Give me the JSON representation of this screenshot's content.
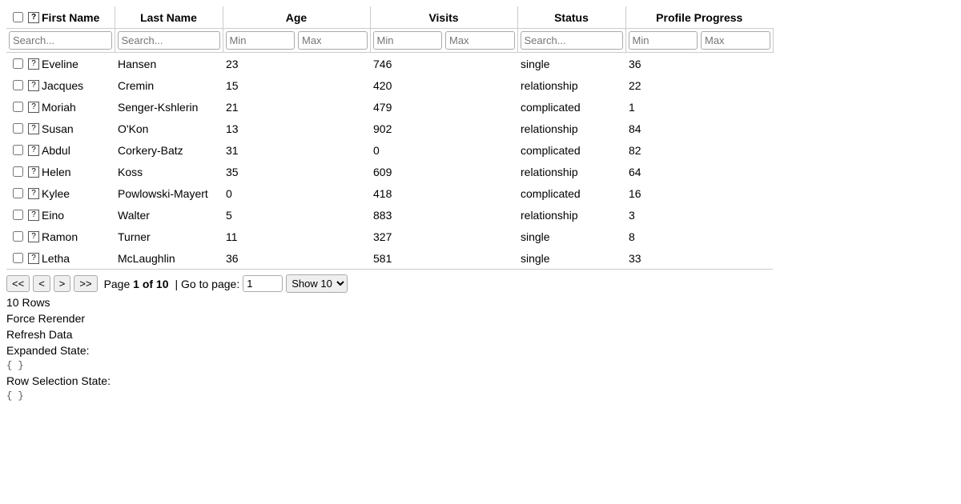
{
  "headers": {
    "firstName": "First Name",
    "lastName": "Last Name",
    "age": "Age",
    "visits": "Visits",
    "status": "Status",
    "progress": "Profile Progress"
  },
  "filters": {
    "searchPlaceholder": "Search...",
    "minPlaceholder": "Min",
    "maxPlaceholder": "Max"
  },
  "expanderGlyph": "?",
  "rows": [
    {
      "firstName": "Eveline",
      "lastName": "Hansen",
      "age": "23",
      "visits": "746",
      "status": "single",
      "progress": "36"
    },
    {
      "firstName": "Jacques",
      "lastName": "Cremin",
      "age": "15",
      "visits": "420",
      "status": "relationship",
      "progress": "22"
    },
    {
      "firstName": "Moriah",
      "lastName": "Senger-Kshlerin",
      "age": "21",
      "visits": "479",
      "status": "complicated",
      "progress": "1"
    },
    {
      "firstName": "Susan",
      "lastName": "O'Kon",
      "age": "13",
      "visits": "902",
      "status": "relationship",
      "progress": "84"
    },
    {
      "firstName": "Abdul",
      "lastName": "Corkery-Batz",
      "age": "31",
      "visits": "0",
      "status": "complicated",
      "progress": "82"
    },
    {
      "firstName": "Helen",
      "lastName": "Koss",
      "age": "35",
      "visits": "609",
      "status": "relationship",
      "progress": "64"
    },
    {
      "firstName": "Kylee",
      "lastName": "Powlowski-Mayert",
      "age": "0",
      "visits": "418",
      "status": "complicated",
      "progress": "16"
    },
    {
      "firstName": "Eino",
      "lastName": "Walter",
      "age": "5",
      "visits": "883",
      "status": "relationship",
      "progress": "3"
    },
    {
      "firstName": "Ramon",
      "lastName": "Turner",
      "age": "11",
      "visits": "327",
      "status": "single",
      "progress": "8"
    },
    {
      "firstName": "Letha",
      "lastName": "McLaughlin",
      "age": "36",
      "visits": "581",
      "status": "single",
      "progress": "33"
    }
  ],
  "pagination": {
    "first": "<<",
    "prev": "<",
    "next": ">",
    "last": ">>",
    "pageLabel": "Page",
    "pageInfo": "1 of 10",
    "gotoLabel": "| Go to page:",
    "gotoValue": "1",
    "pageSizeLabel": "Show 10"
  },
  "footer": {
    "rowCount": "10 Rows",
    "forceRerender": "Force Rerender",
    "refreshData": "Refresh Data",
    "expandedLabel": "Expanded State:",
    "expandedJson": "{ }",
    "selectionLabel": "Row Selection State:",
    "selectionJson": "{ }"
  }
}
